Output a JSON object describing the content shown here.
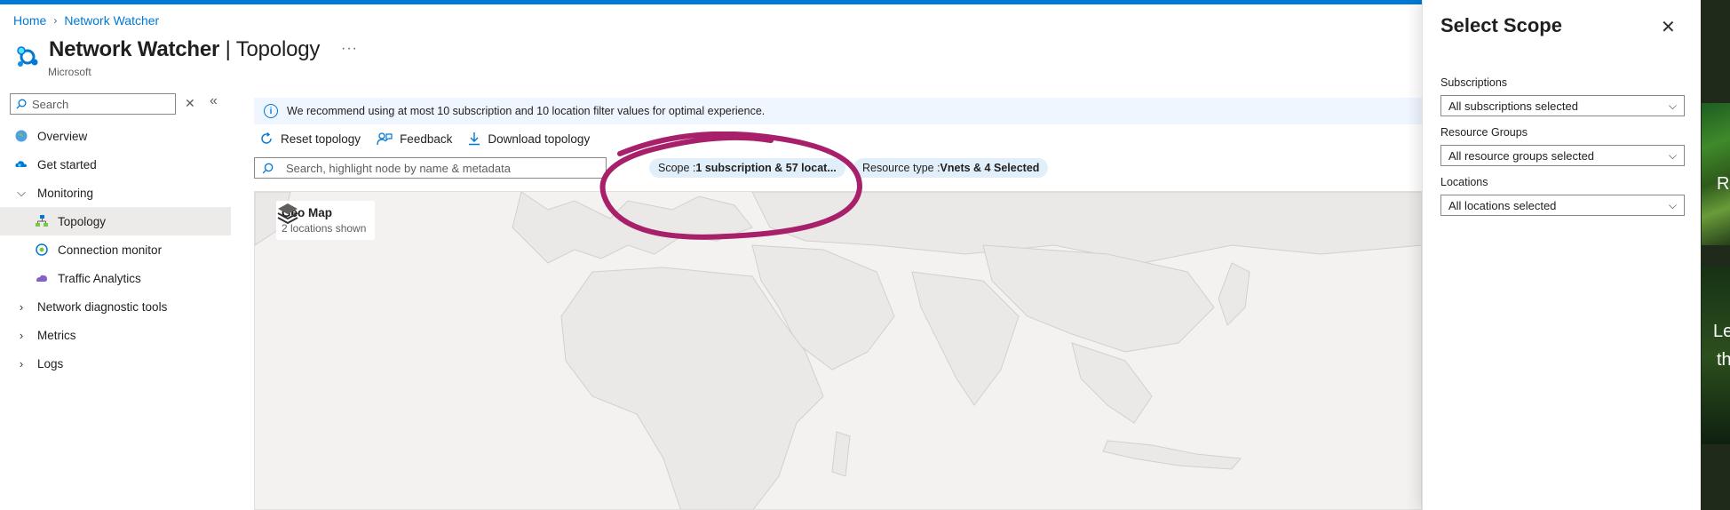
{
  "breadcrumb": {
    "home": "Home",
    "network_watcher": "Network Watcher"
  },
  "header": {
    "title_main": "Network Watcher",
    "title_sep": " | ",
    "title_page": "Topology",
    "subtitle": "Microsoft",
    "more": "···"
  },
  "nav": {
    "search_placeholder": "Search",
    "items": [
      {
        "label": "Overview"
      },
      {
        "label": "Get started"
      },
      {
        "label": "Monitoring"
      },
      {
        "label": "Topology"
      },
      {
        "label": "Connection monitor"
      },
      {
        "label": "Traffic Analytics"
      },
      {
        "label": "Network diagnostic tools"
      },
      {
        "label": "Metrics"
      },
      {
        "label": "Logs"
      }
    ]
  },
  "info_bar": {
    "text": "We recommend using at most 10 subscription and 10 location filter values for optimal experience."
  },
  "toolbar": {
    "reset": "Reset topology",
    "feedback": "Feedback",
    "download": "Download topology"
  },
  "map_search": {
    "placeholder": "Search, highlight node by name & metadata"
  },
  "filters": {
    "scope_label": "Scope : ",
    "scope_value": "1 subscription & 57 locat...",
    "resource_label": "Resource type : ",
    "resource_value": "Vnets & 4 Selected"
  },
  "geo_map": {
    "title": "Geo Map",
    "subtitle": "2 locations shown"
  },
  "panel": {
    "title": "Select Scope",
    "subscriptions_label": "Subscriptions",
    "subscriptions_value": "All subscriptions selected",
    "resource_groups_label": "Resource Groups",
    "resource_groups_value": "All resource groups selected",
    "locations_label": "Locations",
    "locations_value": "All locations selected"
  },
  "background": {
    "letter_r": "R",
    "letter_le": "Le",
    "letter_th": "th"
  },
  "colors": {
    "accent": "#0078d4",
    "annotation": "#a8206a",
    "pill": "#e1effa",
    "map": "#f3f2f1"
  }
}
